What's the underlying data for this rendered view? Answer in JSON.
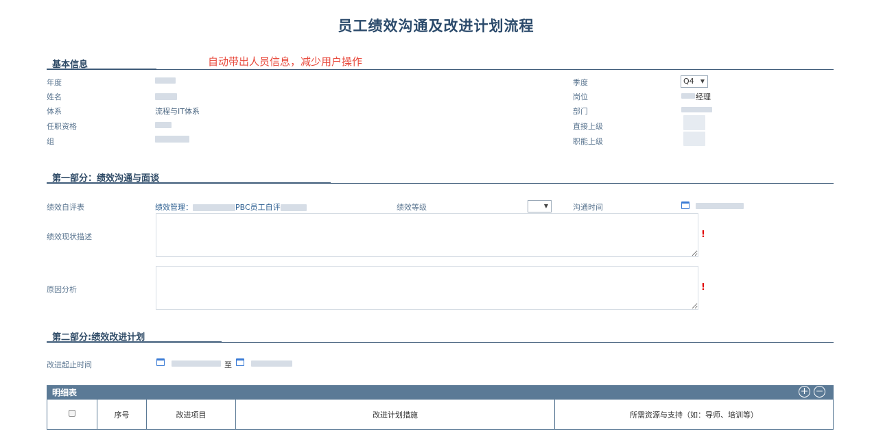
{
  "page_title": "员工绩效沟通及改进计划流程",
  "annotation": "自动带出人员信息，减少用户操作",
  "basic_info": {
    "section_title": "基本信息",
    "left": {
      "year_label": "年度",
      "name_label": "姓名",
      "system_label": "体系",
      "system_value": "流程与IT体系",
      "qualification_label": "任职资格",
      "group_label": "组"
    },
    "right": {
      "quarter_label": "季度",
      "quarter_value": "Q4",
      "position_label": "岗位",
      "position_suffix": "经理",
      "department_label": "部门",
      "direct_supervisor_label": "直接上级",
      "functional_supervisor_label": "职能上级"
    }
  },
  "part1": {
    "section_title": "第一部分：绩效沟通与面谈",
    "self_eval_label": "绩效自评表",
    "self_eval_prefix": "绩效管理：",
    "self_eval_middle": "PBC员工自评",
    "grade_label": "绩效等级",
    "comm_time_label": "沟通时间",
    "status_desc_label": "绩效现状描述",
    "cause_label": "原因分析",
    "required_mark": "!"
  },
  "part2": {
    "section_title": "第二部分:绩效改进计划",
    "period_label": "改进起止时间",
    "period_to": "至"
  },
  "detail_table": {
    "title": "明细表",
    "add_icon": "+",
    "remove_icon": "−",
    "columns": [
      "序号",
      "改进项目",
      "改进计划措施",
      "所需资源与支持（如：导师、培训等）"
    ]
  }
}
